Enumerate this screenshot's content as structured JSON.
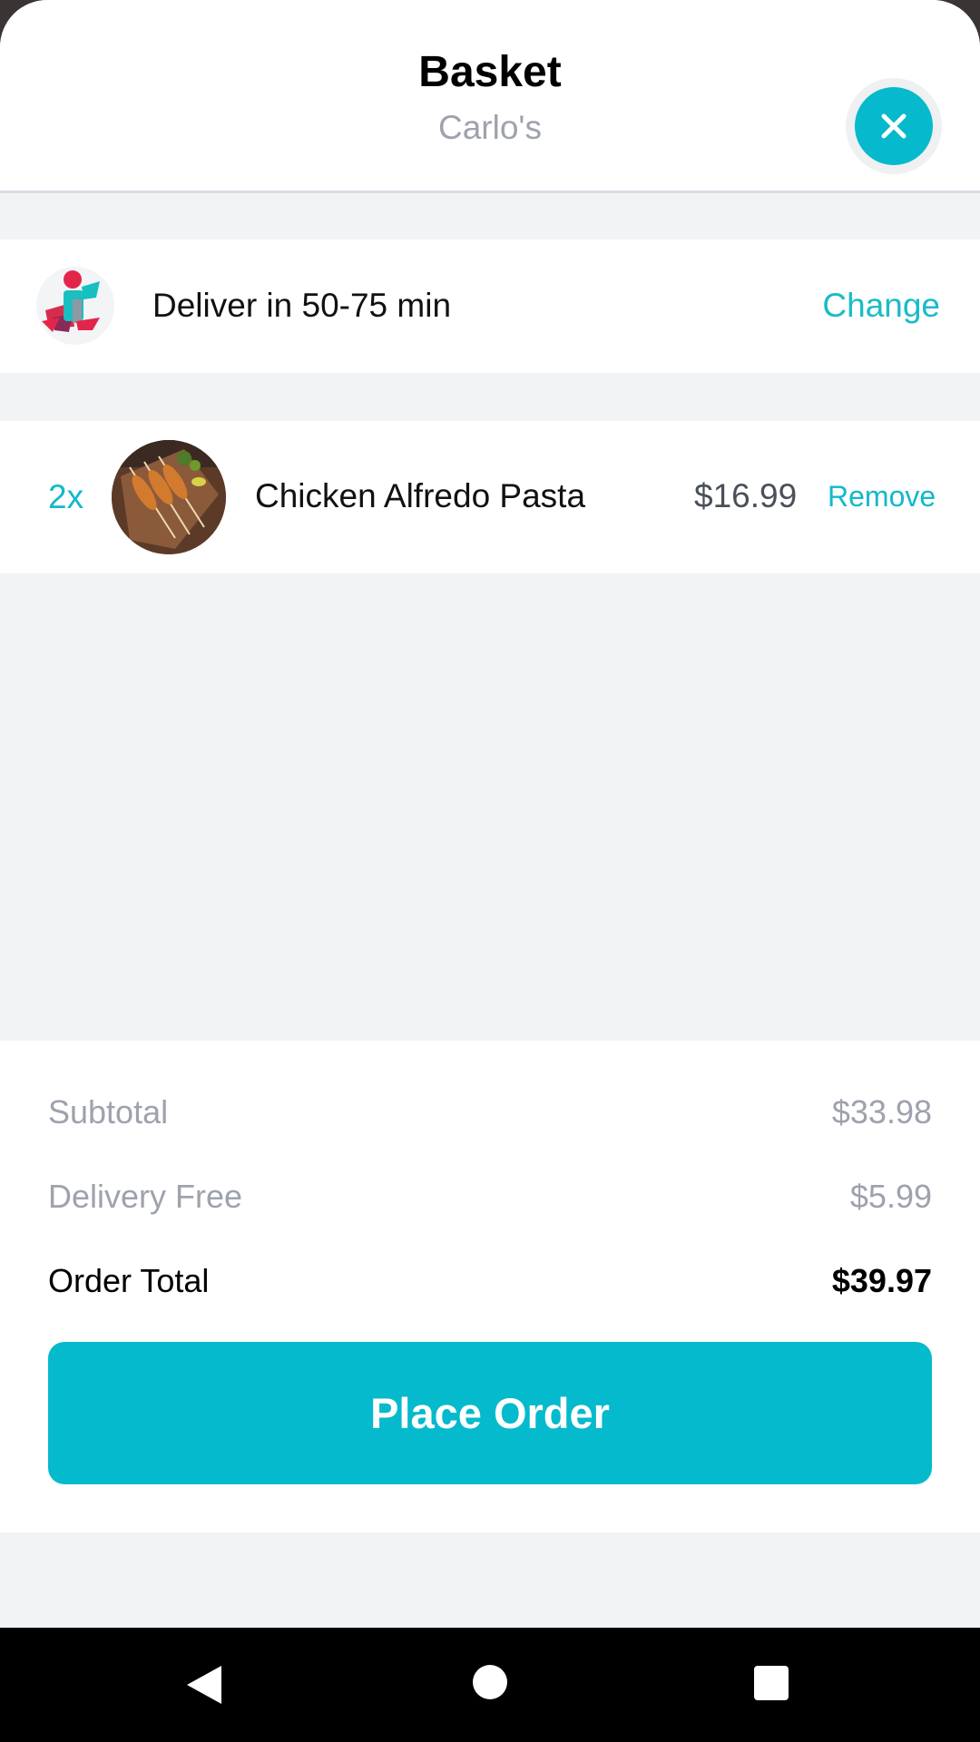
{
  "header": {
    "title": "Basket",
    "subtitle": "Carlo's",
    "close_icon": "close-icon"
  },
  "delivery": {
    "icon": "courier-scooter-icon",
    "text": "Deliver in 50-75 min",
    "change_label": "Change"
  },
  "items": [
    {
      "quantity": "2x",
      "name": "Chicken Alfredo Pasta",
      "price": "$16.99",
      "remove_label": "Remove",
      "image": "food-thumbnail"
    }
  ],
  "summary": {
    "subtotal_label": "Subtotal",
    "subtotal_value": "$33.98",
    "delivery_label": "Delivery Free",
    "delivery_value": "$5.99",
    "total_label": "Order Total",
    "total_value": "$39.97"
  },
  "actions": {
    "place_order": "Place Order"
  },
  "colors": {
    "accent": "#06bacd",
    "muted_text": "#9ea2ad",
    "background": "#f2f3f5"
  }
}
